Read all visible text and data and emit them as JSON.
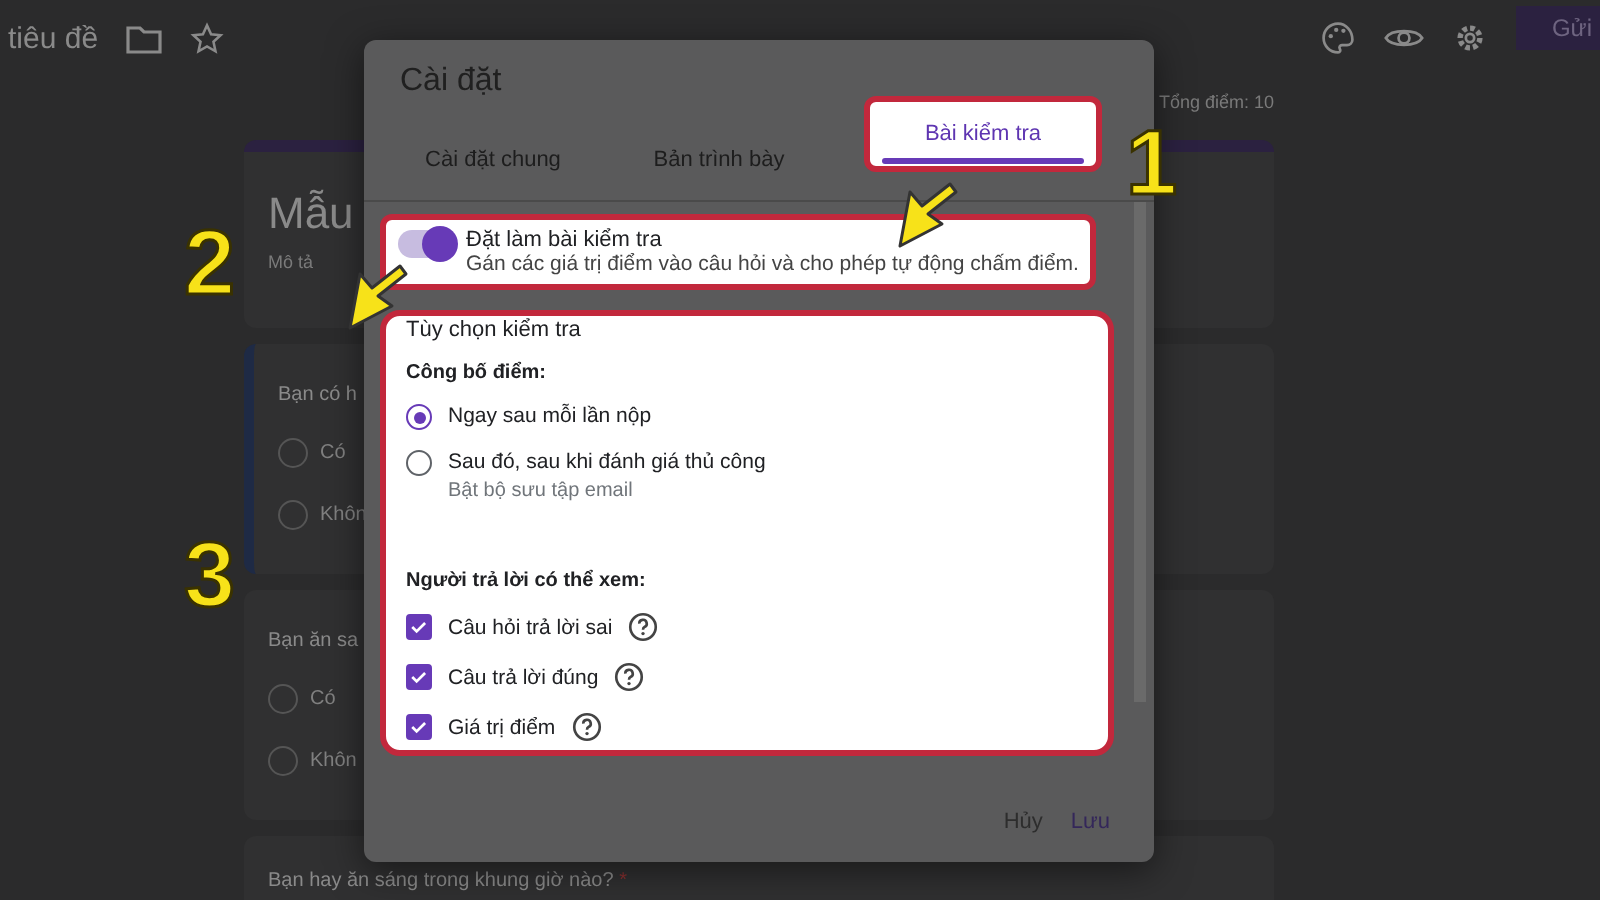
{
  "header": {
    "title": "tiêu đề",
    "send_button": "Gửi"
  },
  "form": {
    "total_points": "Tổng điểm: 10",
    "title": "Mẫu",
    "description": "Mô tả",
    "questions": [
      {
        "title": "Bạn có h",
        "options": [
          {
            "label": "Có"
          },
          {
            "label": "Khôn"
          }
        ],
        "selected": true
      },
      {
        "title": "Bạn ăn sa",
        "options": [
          {
            "label": "Có"
          },
          {
            "label": "Khôn"
          }
        ],
        "selected": false
      },
      {
        "title": "Bạn hay ăn sáng trong khung giờ nào?",
        "required_mark": "*",
        "selected": false
      }
    ]
  },
  "dialog": {
    "title": "Cài đặt",
    "tabs": [
      {
        "label": "Cài đặt chung",
        "selected": false
      },
      {
        "label": "Bản trình bày",
        "selected": false
      },
      {
        "label": "Bài kiểm tra",
        "selected": true
      }
    ],
    "quiz_toggle": {
      "label": "Đặt làm bài kiểm tra",
      "description": "Gán các giá trị điểm vào câu hỏi và cho phép tự động chấm điểm.",
      "on": true
    },
    "options_title": "Tùy chọn kiểm tra",
    "release": {
      "heading": "Công bố điểm:",
      "options": [
        {
          "label": "Ngay sau mỗi lần nộp",
          "selected": true
        },
        {
          "label": "Sau đó, sau khi đánh giá thủ công",
          "sublabel": "Bật bộ sưu tập email",
          "selected": false
        }
      ]
    },
    "visibility": {
      "heading": "Người trả lời có thể xem:",
      "items": [
        {
          "label": "Câu hỏi trả lời sai",
          "checked": true
        },
        {
          "label": "Câu trả lời đúng",
          "checked": true
        },
        {
          "label": "Giá trị điểm",
          "checked": true
        }
      ]
    },
    "buttons": {
      "cancel": "Hủy",
      "save": "Lưu"
    }
  },
  "annotations": [
    {
      "label": "1"
    },
    {
      "label": "2"
    },
    {
      "label": "3"
    }
  ]
}
